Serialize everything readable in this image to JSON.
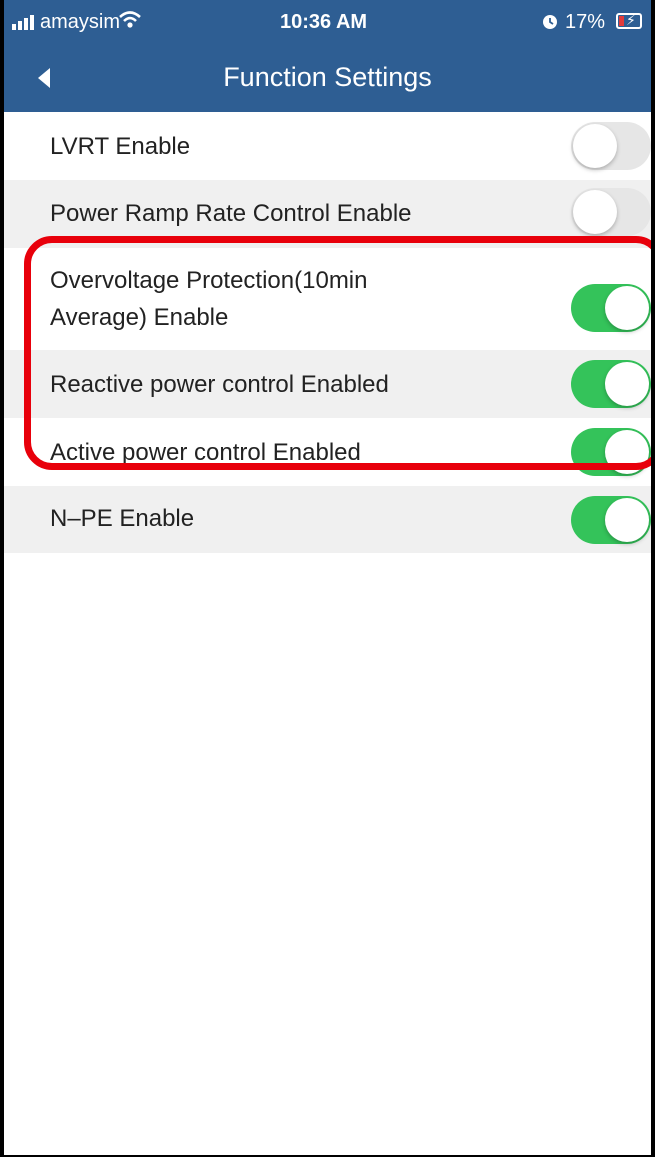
{
  "status_bar": {
    "carrier": "amaysim",
    "time": "10:36 AM",
    "battery_percent": "17%"
  },
  "nav": {
    "title": "Function Settings"
  },
  "settings": [
    {
      "label": "LVRT Enable",
      "enabled": false
    },
    {
      "label": "Power Ramp Rate Control Enable",
      "enabled": false
    },
    {
      "label_line1": "Overvoltage Protection(10min",
      "label_line2": "Average) Enable",
      "enabled": true
    },
    {
      "label": "Reactive power control Enabled",
      "enabled": true
    },
    {
      "label": "Active power control Enabled",
      "enabled": true
    },
    {
      "label": "N–PE Enable",
      "enabled": true
    }
  ],
  "colors": {
    "header": "#2e5e93",
    "toggle_on": "#34c35a",
    "toggle_off": "#e6e6e6",
    "highlight": "#e8000b"
  }
}
